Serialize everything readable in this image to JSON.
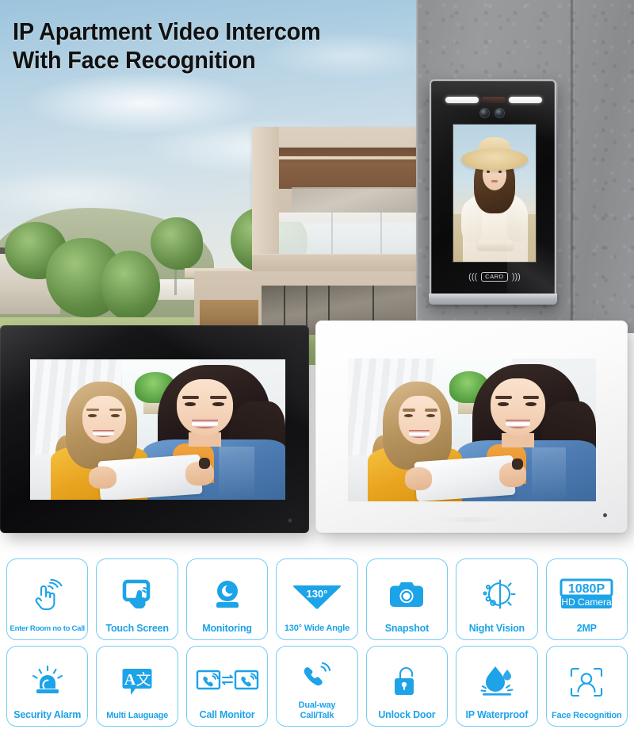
{
  "headline": "IP Apartment Video Intercom\nWith Face Recognition",
  "door_station": {
    "card_label": "CARD",
    "wave_left": "(((",
    "wave_right": ")))"
  },
  "features": [
    {
      "label": "Enter Room no to Call",
      "icon": "touch-call-icon",
      "size": "small"
    },
    {
      "label": "Touch Screen",
      "icon": "touch-screen-icon",
      "size": "normal"
    },
    {
      "label": "Monitoring",
      "icon": "camera-monitor-icon",
      "size": "normal"
    },
    {
      "label": "130°  Wide Angle",
      "icon": "wide-angle-icon",
      "size": "tiny",
      "badge": "130°"
    },
    {
      "label": "Snapshot",
      "icon": "snapshot-camera-icon",
      "size": "normal"
    },
    {
      "label": "Night Vision",
      "icon": "night-vision-icon",
      "size": "normal"
    },
    {
      "label": "2MP",
      "icon": "hd-camera-icon",
      "size": "normal",
      "badge_top": "1080P",
      "badge_bottom": "HD Camera"
    },
    {
      "label": "Security Alarm",
      "icon": "siren-alarm-icon",
      "size": "normal"
    },
    {
      "label": "Multi Lauguage",
      "icon": "translate-icon",
      "size": "tiny",
      "badge": "A",
      "badge2": "文"
    },
    {
      "label": "Call Monitor",
      "icon": "call-monitor-icon",
      "size": "normal"
    },
    {
      "label": "Dual-way\nCall/Talk",
      "icon": "dual-way-talk-icon",
      "size": "tiny"
    },
    {
      "label": "Unlock Door",
      "icon": "unlock-padlock-icon",
      "size": "normal"
    },
    {
      "label": "IP Waterproof",
      "icon": "water-drop-icon",
      "size": "normal"
    },
    {
      "label": "Face Recognition",
      "icon": "face-recognition-icon",
      "size": "tiny"
    }
  ],
  "colors": {
    "accent_blue": "#1CA3E8",
    "card_border": "#74cdf4",
    "title_text": "#111111"
  }
}
